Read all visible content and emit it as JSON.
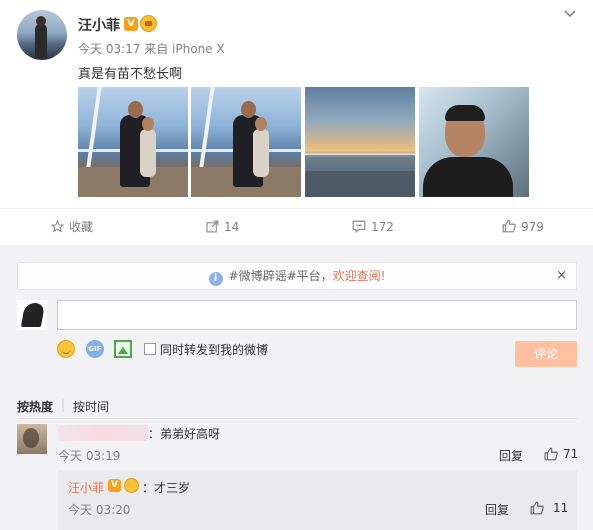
{
  "post": {
    "author": "汪小菲",
    "v_badge": "V",
    "time": "今天 03:17",
    "source": "来自 iPhone X",
    "text": "真是有苗不愁长啊"
  },
  "actions": {
    "favorite": "收藏",
    "repost_count": "14",
    "comment_count": "172",
    "like_count": "979"
  },
  "notice": {
    "prefix": "#微博辟谣#平台，",
    "link": "欢迎查阅!",
    "close": "×"
  },
  "composer": {
    "input_value": "",
    "gif_label": "GIF",
    "repost_checkbox_label": "同时转发到我的微博",
    "submit": "评论"
  },
  "sort": {
    "hot": "按热度",
    "separator": "|",
    "time": "按时间"
  },
  "comments": [
    {
      "text": "：弟弟好高呀",
      "time": "今天 03:19",
      "reply": "回复",
      "likes": "71",
      "sub_reply": {
        "author": "汪小菲",
        "v_badge": "V",
        "text": "：才三岁",
        "time": "今天 03:20",
        "reply": "回复",
        "likes": "11"
      }
    }
  ],
  "icons": {
    "more": "chevron-down-icon",
    "favorite": "star-icon",
    "repost": "repost-icon",
    "comment": "comment-icon",
    "like": "thumbs-up-icon"
  },
  "colors": {
    "accent": "#eb7350",
    "vip_badge": "#f7a11a",
    "submit_disabled": "#ffc09f"
  }
}
